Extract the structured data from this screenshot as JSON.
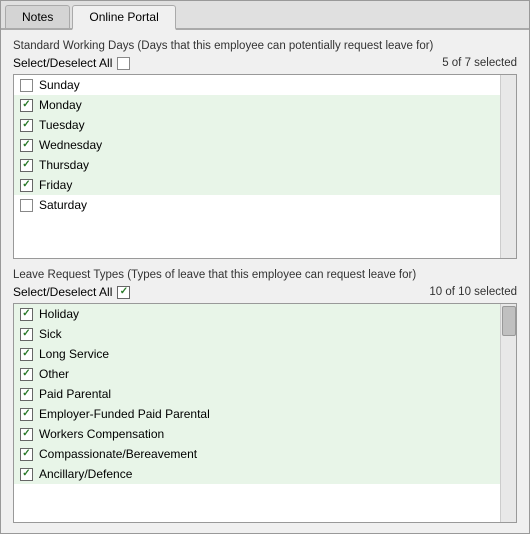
{
  "tabs": [
    {
      "id": "notes",
      "label": "Notes",
      "active": false
    },
    {
      "id": "online-portal",
      "label": "Online Portal",
      "active": true
    }
  ],
  "working_days": {
    "section_label": "Standard Working Days (Days that this employee can potentially request leave for)",
    "select_all_label": "Select/Deselect All",
    "count_label": "5 of 7 selected",
    "days": [
      {
        "label": "Sunday",
        "checked": false
      },
      {
        "label": "Monday",
        "checked": true
      },
      {
        "label": "Tuesday",
        "checked": true
      },
      {
        "label": "Wednesday",
        "checked": true
      },
      {
        "label": "Thursday",
        "checked": true
      },
      {
        "label": "Friday",
        "checked": true
      },
      {
        "label": "Saturday",
        "checked": false
      }
    ]
  },
  "leave_types": {
    "section_label": "Leave Request Types (Types of leave that this employee can request leave for)",
    "select_all_label": "Select/Deselect All",
    "count_label": "10 of 10 selected",
    "types": [
      {
        "label": "Holiday",
        "checked": true
      },
      {
        "label": "Sick",
        "checked": true
      },
      {
        "label": "Long Service",
        "checked": true
      },
      {
        "label": "Other",
        "checked": true
      },
      {
        "label": "Paid Parental",
        "checked": true
      },
      {
        "label": "Employer-Funded Paid Parental",
        "checked": true
      },
      {
        "label": "Workers Compensation",
        "checked": true
      },
      {
        "label": "Compassionate/Bereavement",
        "checked": true
      },
      {
        "label": "Ancillary/Defence",
        "checked": true
      }
    ]
  }
}
